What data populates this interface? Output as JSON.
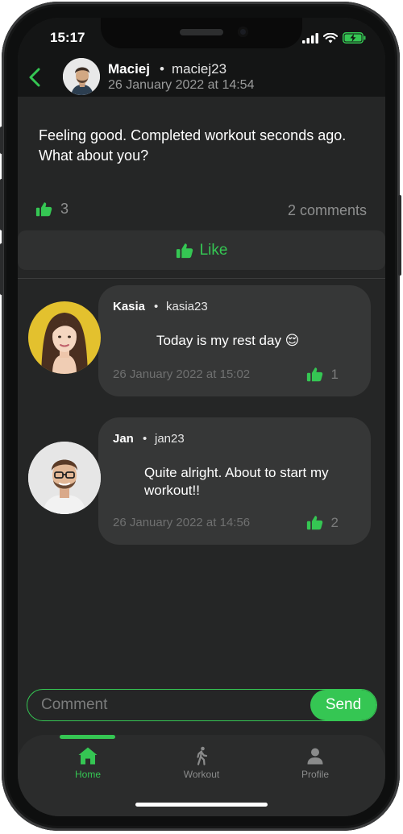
{
  "status_bar": {
    "time": "15:17"
  },
  "header": {
    "author_name": "Maciej",
    "separator": "•",
    "author_handle": "maciej23",
    "date": "26 January 2022 at 14:54"
  },
  "post": {
    "text": "Feeling good. Completed workout seconds ago. What about you?",
    "likes_count": "3",
    "comments_label": "2 comments",
    "like_button_label": "Like"
  },
  "comments": [
    {
      "name": "Kasia",
      "separator": "•",
      "handle": "kasia23",
      "text": "Today is my rest day 😌",
      "date": "26 January 2022 at 15:02",
      "likes": "1"
    },
    {
      "name": "Jan",
      "separator": "•",
      "handle": "jan23",
      "text": "Quite alright. About to start my workout!!",
      "date": "26 January 2022 at 14:56",
      "likes": "2"
    }
  ],
  "comment_input": {
    "placeholder": "Comment",
    "send_label": "Send"
  },
  "tabs": [
    {
      "label": "Home",
      "icon": "home-icon",
      "active": true
    },
    {
      "label": "Workout",
      "icon": "walking-figure-icon",
      "active": false
    },
    {
      "label": "Profile",
      "icon": "person-icon",
      "active": false
    }
  ],
  "colors": {
    "accent": "#35c653",
    "background": "#252626",
    "header_bg": "#141515",
    "bubble_bg": "#363737",
    "muted_text": "#8e8f8f"
  }
}
